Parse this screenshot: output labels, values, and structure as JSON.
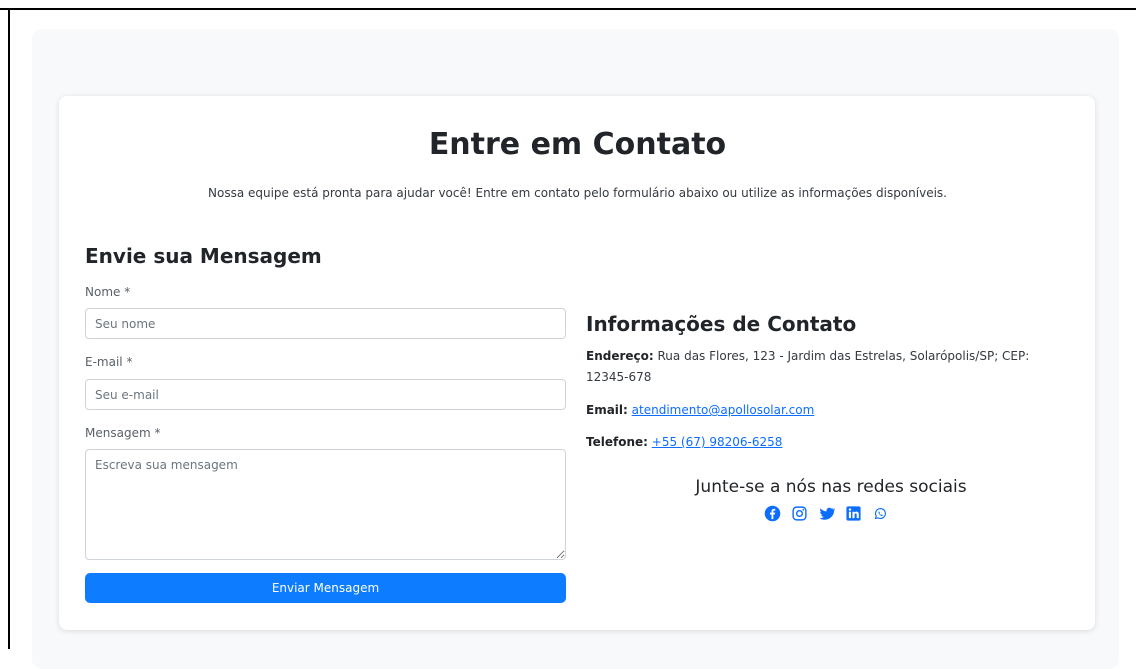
{
  "page": {
    "title": "Entre em Contato",
    "intro": "Nossa equipe está pronta para ajudar você! Entre em contato pelo formulário abaixo ou utilize as informações disponíveis."
  },
  "form": {
    "title": "Envie sua Mensagem",
    "name_label": "Nome *",
    "name_placeholder": "Seu nome",
    "email_label": "E-mail *",
    "email_placeholder": "Seu e-mail",
    "message_label": "Mensagem *",
    "message_placeholder": "Escreva sua mensagem",
    "submit_label": "Enviar Mensagem"
  },
  "info": {
    "title": "Informações de Contato",
    "address_label": "Endereço:",
    "address_value": " Rua das Flores, 123 - Jardim das Estrelas, Solarópolis/SP; CEP: 12345-678",
    "email_label": "Email:",
    "email_value": "atendimento@apollosolar.com",
    "phone_label": "Telefone:",
    "phone_value": "+55 (67) 98206-6258"
  },
  "social": {
    "title": "Junte-se a nós nas redes sociais",
    "icons": [
      "facebook-icon",
      "instagram-icon",
      "twitter-icon",
      "linkedin-icon",
      "whatsapp-icon"
    ],
    "icon_color": "#0d6efd"
  },
  "colors": {
    "primary": "#0d7cff",
    "link": "#0d6efd",
    "background": "#f8f9fa"
  }
}
